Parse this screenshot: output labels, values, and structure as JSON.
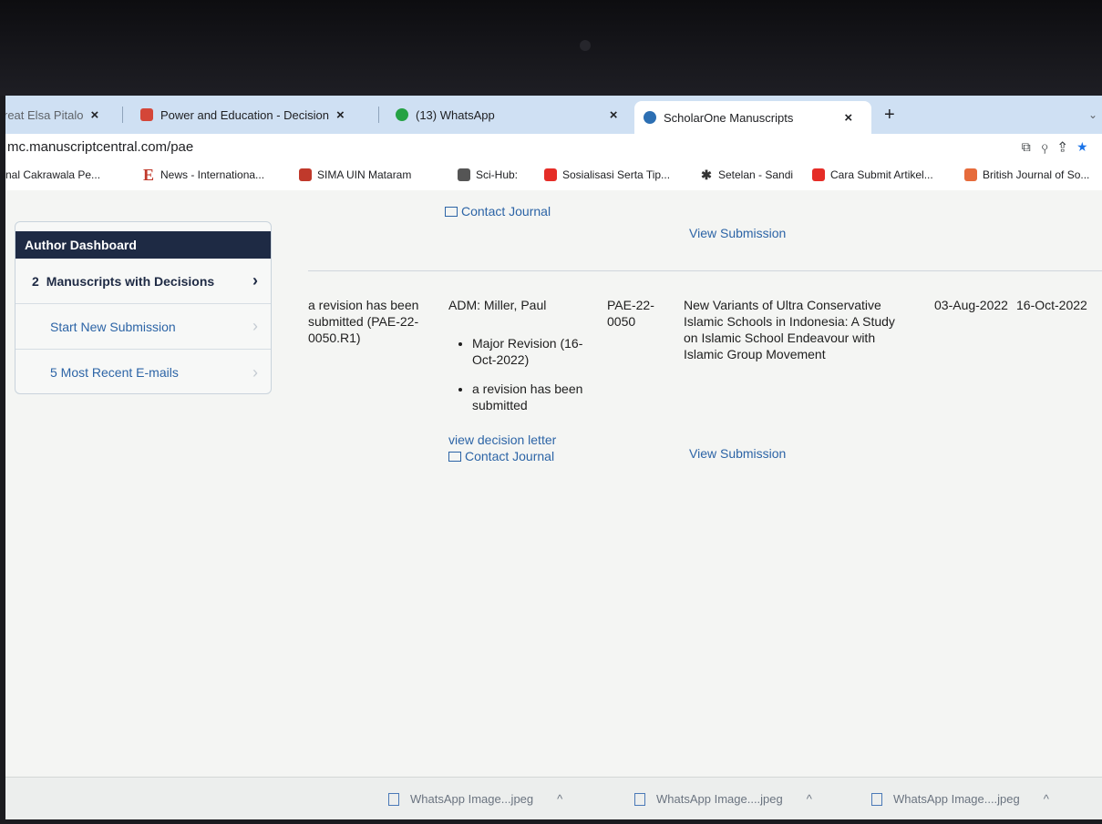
{
  "browser": {
    "tabs": [
      {
        "label": "reat Elsa Pitalo",
        "active": false
      },
      {
        "label": "Power and Education - Decision",
        "active": false
      },
      {
        "label": "(13) WhatsApp",
        "active": false
      },
      {
        "label": "ScholarOne Manuscripts",
        "active": true
      }
    ],
    "close_glyph": "×",
    "new_tab_glyph": "+",
    "url": "mc.manuscriptcentral.com/pae",
    "bookmarks": [
      "nal Cakrawala Pe...",
      "News - Internationa...",
      "SIMA UIN Mataram",
      "Sci-Hub:",
      "Sosialisasi Serta Tip...",
      "Setelan - Sandi",
      "Cara Submit Artikel...",
      "British Journal of So..."
    ]
  },
  "sidebar": {
    "title": "Author Dashboard",
    "items": [
      {
        "count": "2",
        "label": "Manuscripts with Decisions",
        "selected": true
      },
      {
        "label": "Start New Submission",
        "selected": false
      },
      {
        "label": "5 Most Recent E-mails",
        "selected": false
      }
    ]
  },
  "prev_row": {
    "contact": "Contact Journal",
    "view_submission": "View Submission"
  },
  "manuscript": {
    "status": "a revision has been submitted (PAE-22-0050.R1)",
    "decision_admin": "ADM: Miller, Paul",
    "decisions": [
      "Major Revision (16-Oct-2022)",
      "a revision has been submitted"
    ],
    "view_decision_letter": "view decision letter",
    "contact": "Contact Journal",
    "id": "PAE-22-0050",
    "title": "New Variants of Ultra Conservative Islamic Schools in Indonesia:  A Study on Islamic School Endeavour with Islamic Group Movement",
    "view_submission": "View Submission",
    "submitted": "03-Aug-2022",
    "decisioned": "16-Oct-2022"
  },
  "downloads": [
    {
      "label": "WhatsApp Image...jpeg"
    },
    {
      "label": "WhatsApp Image....jpeg"
    },
    {
      "label": "WhatsApp Image....jpeg"
    }
  ],
  "colors": {
    "tabstrip": "#cfe0f3",
    "dashboard_header": "#1e2a44",
    "link": "#2c64a6"
  }
}
